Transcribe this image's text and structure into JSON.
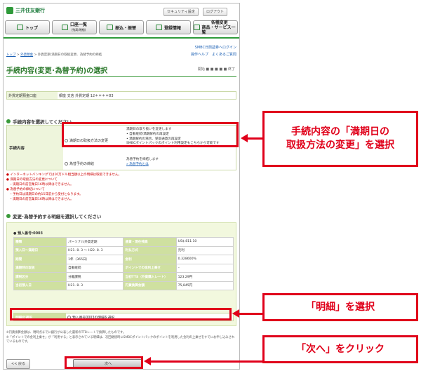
{
  "bank": {
    "name": "三井住友銀行"
  },
  "topbar": {
    "security_label": "セキュリティ設定",
    "logout_label": "ログアウト"
  },
  "nav": [
    {
      "label": "トップ",
      "sub": ""
    },
    {
      "label": "口座一覧",
      "sub": "(残高/明細)"
    },
    {
      "label": "振込・振替",
      "sub": ""
    },
    {
      "label": "登録情報",
      "sub": ""
    },
    {
      "label": "各種変更",
      "sub": "商品・サービス一覧"
    }
  ],
  "links": {
    "smbc": "SMBC日興証券へログイン",
    "guide": "操作ヘルプ",
    "faq": "よくあるご質問"
  },
  "breadcrumb": {
    "top": "トップ",
    "foreign": "外貨預金",
    "current": "外貨定期:満期日の取扱変更、為替予約の締結"
  },
  "steps": "開始 ■ ■ ■ ■ ■ 終了",
  "page_title": "手続内容(変更･為替予約)の選択",
  "account": {
    "key": "外貨定期預金口座",
    "value": "銀座 支店 外貨定期 12＊＊＊＊83"
  },
  "section1": "手続内容を選択してください",
  "proc": {
    "label": "手続内容",
    "opt1": "満期日の取扱方法の変更",
    "desc1": [
      "満期日の取り扱いを変更します",
      "• 自動継続/満期解約の再設定",
      "• 満期解約の場合、受取通貨の再設定",
      "SMBCポイントパックのポイント利用設定もこちらから可能です"
    ],
    "opt2": "為替予約の締結",
    "desc2": [
      "為替予約を締結します",
      "» 為替予約とは"
    ]
  },
  "notes": [
    "● インターネットバンキングでは10万ドル相当額以上の明細は取扱できません。",
    "● 満期日の取扱方法の変更について",
    "　・満期日の前営業日16時以降はできません。",
    "● 為替予約の締結について",
    "　・予約日は満期日の約15日前から受付となります。",
    "　・満期日の前営業日16時以降はできません。"
  ],
  "section2": "変更･為替予約する明細を選択してください",
  "product": {
    "title": "● 預入番号:0003",
    "rows": [
      [
        "種類",
        "パーソナル外貨定期",
        "通貨・現在残高",
        "US$ 811.10"
      ],
      [
        "預入日～満期日",
        "H21. 8. 3 ～ H22. 8. 3",
        "利払方式",
        "元利"
      ],
      [
        "期間",
        "1年（365日）",
        "金利",
        "0.328600%"
      ],
      [
        "満期時の取扱",
        "自動継続",
        "ポイントでの金利上乗せ",
        "–"
      ],
      [
        "課税区分",
        "分離課税",
        "当初TTS（外貨購入レート）",
        "123.29円"
      ],
      [
        "当初預入日",
        "H21. 8. 3",
        "円貨換算金額",
        "75,845円"
      ]
    ],
    "select_label": "明細の選択",
    "select_value": "預入番号0003の明細を選択"
  },
  "footnotes": [
    "※円貨換算金額は、現時点までに銀行が公表した最新のTTBレートで換算したものです。",
    "※「ポイントでの金利上乗せ」が「利用する」と表示されている明細は、次回継続時にSMBCポイントパックのポイントを利用した金利の上乗せをすでにお申し込みされているものです。"
  ],
  "buttons": {
    "back": "<< 戻る",
    "next": "次へ"
  },
  "callouts": {
    "c1": "手続内容の「満期日の\n取扱方法の変更」を選択",
    "c2": "「明細」を選択",
    "c3": "「次へ」をクリック"
  },
  "colors": {
    "accent": "#e0001a",
    "brand": "#2f9a3a"
  }
}
